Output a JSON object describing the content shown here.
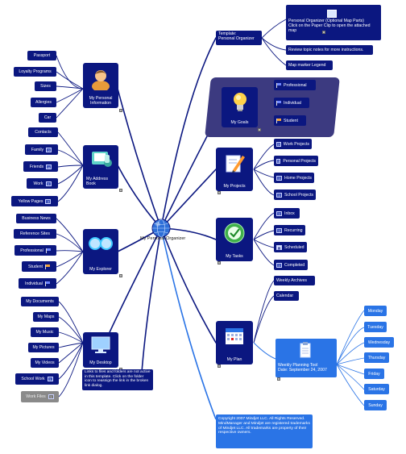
{
  "center": {
    "label": "My Personal Organizer"
  },
  "template": {
    "label": "Template:\nPersonal Organizer"
  },
  "organizer_note": {
    "label": "Personal Organizer (Optional Map Parts)\nClick on the Paper Clip to open the attached map"
  },
  "review_note": {
    "label": "Review topic notes for more instructions."
  },
  "legend": {
    "label": "Map marker Legend"
  },
  "personal_info": {
    "label": "My Personal\nInformation",
    "items": [
      "Passport",
      "Loyalty Programs",
      "Sizes",
      "Allergies",
      "Car"
    ]
  },
  "address_book": {
    "label": "My Address\nBook",
    "items": [
      "Contacts",
      "Family",
      "Friends",
      "Work",
      "Yellow Pages"
    ]
  },
  "explorer": {
    "label": "My Explorer",
    "items": [
      "Business News",
      "Reference Sites",
      "Professional",
      "Student",
      "Individual"
    ]
  },
  "desktop": {
    "label": "My Desktop",
    "items": [
      "My Documents",
      "My Maps",
      "My Music",
      "My Pictures",
      "My Videos",
      "School Work",
      "Work Files"
    ],
    "note": "Links to files and folders are not active in this template. Click on the folder icon to reassign the link in the broken link dialog."
  },
  "goals": {
    "label": "My Goals",
    "items": [
      "Professional",
      "Individual",
      "Student"
    ]
  },
  "projects": {
    "label": "My Projects",
    "items": [
      "Work Projects",
      "Personal Projects",
      "Home Projects",
      "School Projects"
    ]
  },
  "tasks": {
    "label": "My Tasks",
    "items": [
      "Inbox",
      "Recurring",
      "Scheduled",
      "Completed"
    ]
  },
  "plan": {
    "label": "My Plan",
    "items": [
      "Weekly Archives",
      "Calendar"
    ]
  },
  "weekly_tool": {
    "label": "Weekly Planning Tool\nDate:  September 24, 2007"
  },
  "days": [
    "Monday",
    "Tuesday",
    "Wednesday",
    "Thursday",
    "Friday",
    "Saturday",
    "Sunday"
  ],
  "copyright": {
    "label": "Copyright 2007 Mindjet LLC.  All Rights Reserved.\nMindManager and Mindjet are registered trademarks of Mindjet LLC. All trademarks are property of their respective owners."
  },
  "colors": {
    "node": "#0b1780",
    "accent": "#2a74e6",
    "line": "#0b1780",
    "disabled": "#8a8a8a",
    "goals_panel": "#3c3a80"
  }
}
